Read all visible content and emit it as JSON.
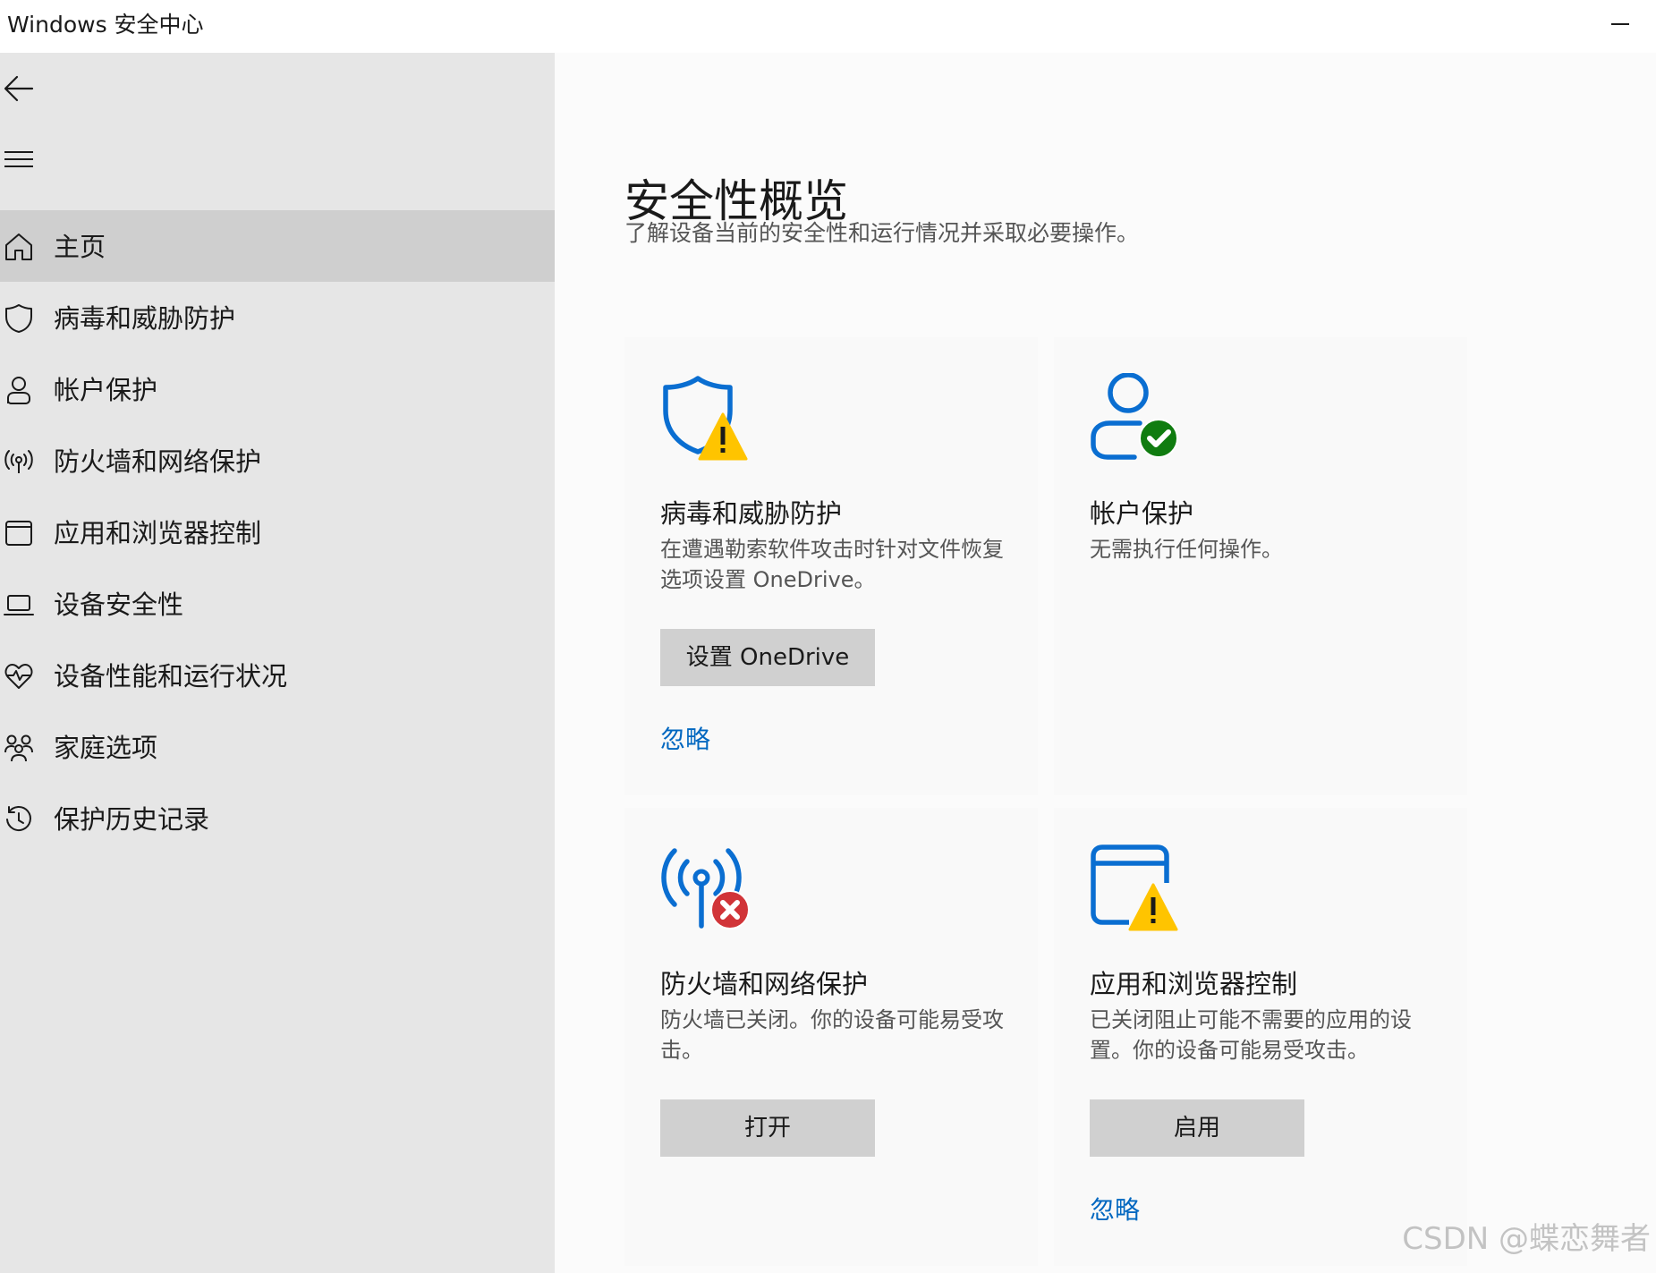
{
  "window": {
    "title": "Windows 安全中心"
  },
  "sidebar": {
    "items": [
      {
        "label": "主页",
        "icon": "home-icon",
        "selected": true
      },
      {
        "label": "病毒和威胁防护",
        "icon": "shield-icon",
        "selected": false
      },
      {
        "label": "帐户保护",
        "icon": "person-icon",
        "selected": false
      },
      {
        "label": "防火墙和网络保护",
        "icon": "wireless-icon",
        "selected": false
      },
      {
        "label": "应用和浏览器控制",
        "icon": "app-window-icon",
        "selected": false
      },
      {
        "label": "设备安全性",
        "icon": "laptop-icon",
        "selected": false
      },
      {
        "label": "设备性能和运行状况",
        "icon": "heart-pulse-icon",
        "selected": false
      },
      {
        "label": "家庭选项",
        "icon": "family-icon",
        "selected": false
      },
      {
        "label": "保护历史记录",
        "icon": "history-icon",
        "selected": false
      }
    ]
  },
  "main": {
    "title": "安全性概览",
    "subtitle": "了解设备当前的安全性和运行情况并采取必要操作。",
    "cards": [
      {
        "title": "病毒和威胁防护",
        "description": "在遭遇勒索软件攻击时针对文件恢复选项设置 OneDrive。",
        "button": "设置 OneDrive",
        "link": "忽略",
        "icon": "shield-warning-icon",
        "status": "warning"
      },
      {
        "title": "帐户保护",
        "description": "无需执行任何操作。",
        "icon": "account-check-icon",
        "status": "ok"
      },
      {
        "title": "防火墙和网络保护",
        "description": "防火墙已关闭。你的设备可能易受攻击。",
        "button": "打开",
        "icon": "wireless-error-icon",
        "status": "error"
      },
      {
        "title": "应用和浏览器控制",
        "description": "已关闭阻止可能不需要的应用的设置。你的设备可能易受攻击。",
        "button": "启用",
        "link": "忽略",
        "icon": "browser-warning-icon",
        "status": "warning"
      }
    ]
  },
  "watermark": "CSDN @蝶恋舞者",
  "colors": {
    "accent": "#0067c0",
    "icon_blue": "#0a6ed1",
    "warning": "#ffc400",
    "ok": "#107c10",
    "error": "#d13438",
    "sidebar_bg": "#e6e6e6",
    "selected_bg": "#cfcfcf",
    "button_bg": "#d0d0d0"
  }
}
